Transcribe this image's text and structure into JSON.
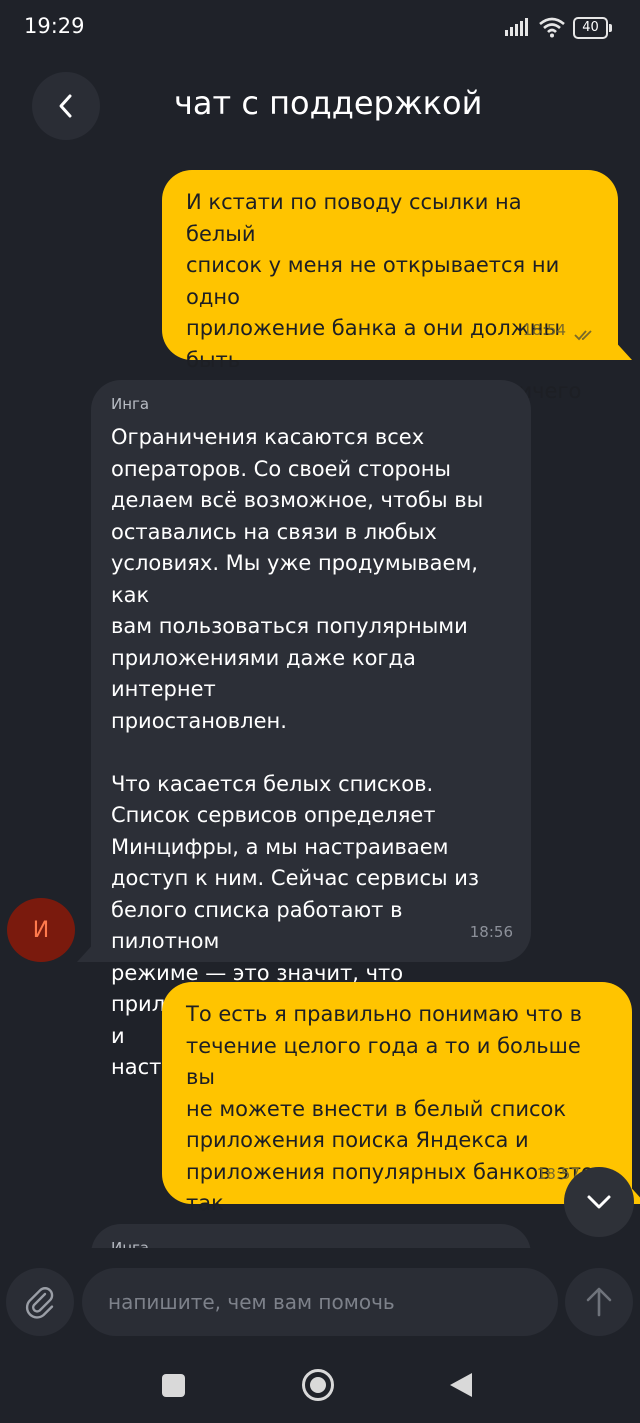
{
  "status_bar": {
    "time": "19:29",
    "battery": "40"
  },
  "header": {
    "title": "чат с поддержкой"
  },
  "messages": [
    {
      "direction": "outgoing",
      "text": "И кстати по поводу ссылки на белый\nсписок у меня не открывается ни одно\nприложение банка а они должны быть\nв белом списке не работает ничего\nкроме приложения озона",
      "time": "18:54",
      "read": true
    },
    {
      "direction": "incoming",
      "sender": "Инга",
      "text": "Ограничения касаются всех\nоператоров. Со своей стороны\nделаем всё возможное, чтобы вы\nоставались на связи в любых\nусловиях. Мы уже продумываем, как\nвам пользоваться популярными\nприложениями даже когда интернет\nприостановлен.\n\nЧто касается белых списков.\nСписок сервисов определяет\nМинцифры, а мы настраиваем\nдоступ к ним. Сейчас сервисы из\nбелого списка работают в пилотном\nрежиме — это значит, что\nприложения и сайты добавляются и\nнастраиваются постепенно.",
      "time": "18:56"
    },
    {
      "direction": "outgoing",
      "text": "То есть я правильно понимаю что в\nтечение целого года а то и больше вы\nне можете внести в белый список\nприложения поиска Яндекса и\nприложения популярных банков это\nтак",
      "time": "18:57"
    },
    {
      "direction": "incoming",
      "sender": "Инга"
    }
  ],
  "avatar": {
    "initial": "И"
  },
  "composer": {
    "placeholder": "напишите, чем вам помочь"
  },
  "colors": {
    "background": "#1f2229",
    "outgoing_bubble": "#ffc400",
    "incoming_bubble": "#2c2f37",
    "avatar_bg": "#7a1a0d",
    "avatar_text": "#ff7a4d"
  }
}
